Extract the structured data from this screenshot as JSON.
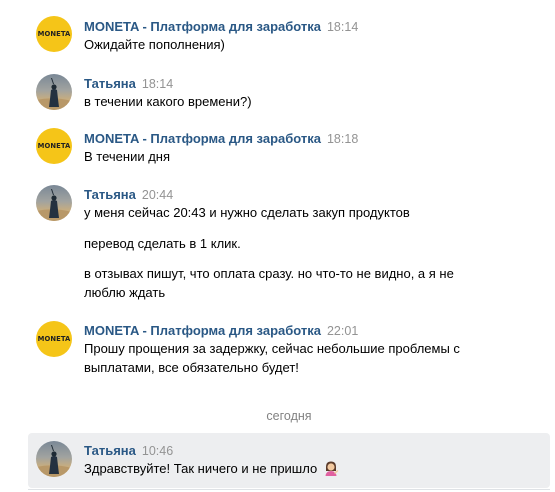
{
  "messages": [
    {
      "author": "MONETA - Платформа для заработка",
      "time": "18:14",
      "avatar": "moneta-logo",
      "lines": [
        "Ожидайте пополнения)"
      ]
    },
    {
      "author": "Татьяна",
      "time": "18:14",
      "avatar": "user-photo",
      "lines": [
        "в течении какого времени?)"
      ]
    },
    {
      "author": "MONETA - Платформа для заработка",
      "time": "18:18",
      "avatar": "moneta-logo",
      "lines": [
        "В течении дня"
      ]
    },
    {
      "author": "Татьяна",
      "time": "20:44",
      "avatar": "user-photo",
      "lines": [
        "у меня сейчас 20:43 и нужно сделать закуп продуктов",
        "перевод сделать в 1 клик.",
        "в отзывах пишут, что оплата сразу. но что-то не видно, а я не",
        "люблю ждать"
      ]
    },
    {
      "author": "MONETA - Платформа для заработка",
      "time": "22:01",
      "avatar": "moneta-logo",
      "lines": [
        "Прошу прощения за задержку, сейчас небольшие проблемы с",
        "выплатами, все обязательно будет!"
      ]
    },
    {
      "author": "Татьяна",
      "time": "10:46",
      "avatar": "user-photo",
      "lines": [
        "Здравствуйте! Так ничего и не пришло"
      ],
      "emoji": "woman-tipping-hand-emoji"
    }
  ],
  "moneta_avatar_text": "MONETA",
  "date_separator": "сегодня",
  "colors": {
    "author_link": "#2a5885",
    "timestamp": "#939393",
    "moneta_yellow": "#f5c518",
    "highlight_bg": "#edeef0"
  }
}
